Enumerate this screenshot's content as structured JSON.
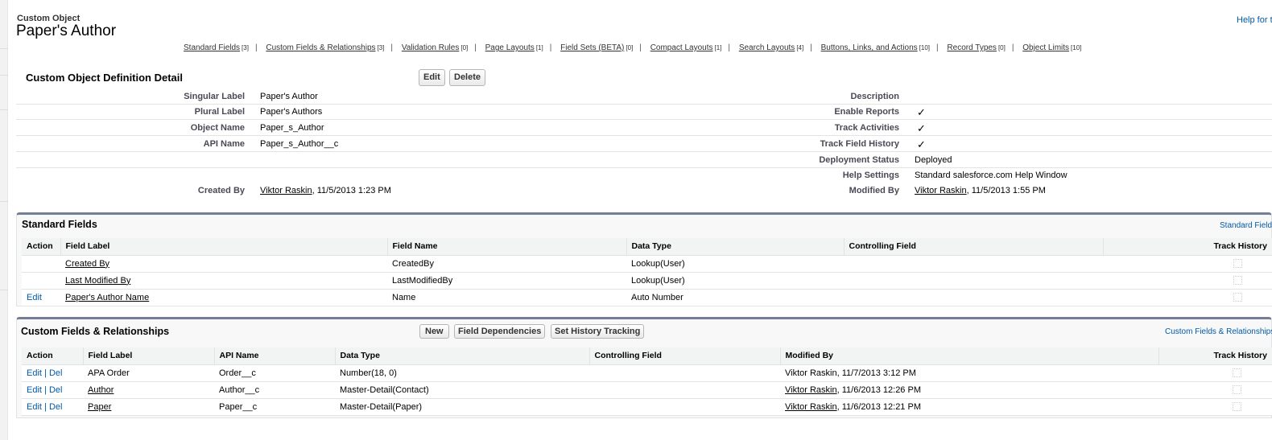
{
  "header": {
    "object_type": "Custom Object",
    "title": "Paper's Author",
    "help_link": "Help for this Page"
  },
  "nav_links": [
    {
      "label": "Standard Fields",
      "count": "[3]"
    },
    {
      "label": "Custom Fields & Relationships",
      "count": "[3]"
    },
    {
      "label": "Validation Rules",
      "count": "[0]"
    },
    {
      "label": "Page Layouts",
      "count": "[1]"
    },
    {
      "label": "Field Sets (BETA)",
      "count": "[0]"
    },
    {
      "label": "Compact Layouts",
      "count": "[1]"
    },
    {
      "label": "Search Layouts",
      "count": "[4]"
    },
    {
      "label": "Buttons, Links, and Actions",
      "count": "[10]"
    },
    {
      "label": "Record Types",
      "count": "[0]"
    },
    {
      "label": "Object Limits",
      "count": "[10]"
    }
  ],
  "detail": {
    "title": "Custom Object Definition Detail",
    "edit_button": "Edit",
    "delete_button": "Delete",
    "left": [
      {
        "label": "Singular Label",
        "value": "Paper's Author"
      },
      {
        "label": "Plural Label",
        "value": "Paper's Authors"
      },
      {
        "label": "Object Name",
        "value": "Paper_s_Author"
      },
      {
        "label": "API Name",
        "value": "Paper_s_Author__c"
      }
    ],
    "right": [
      {
        "label": "Description",
        "value": ""
      },
      {
        "label": "Enable Reports",
        "checked": true
      },
      {
        "label": "Track Activities",
        "checked": true
      },
      {
        "label": "Track Field History",
        "checked": true
      },
      {
        "label": "Deployment Status",
        "value": "Deployed"
      },
      {
        "label": "Help Settings",
        "value": "Standard salesforce.com Help Window"
      }
    ],
    "created_by": {
      "label": "Created By",
      "user": "Viktor Raskin",
      "date": ", 11/5/2013 1:23 PM"
    },
    "modified_by": {
      "label": "Modified By",
      "user": "Viktor Raskin",
      "date": ", 11/5/2013 1:55 PM"
    },
    "check_glyph": "✓"
  },
  "standard_fields": {
    "title": "Standard Fields",
    "help_link": "Standard Fields Help",
    "columns": [
      "Action",
      "Field Label",
      "Field Name",
      "Data Type",
      "Controlling Field",
      "Track History"
    ],
    "rows": [
      {
        "action": "",
        "label": "Created By",
        "name": "CreatedBy",
        "type": "Lookup(User)",
        "controlling": "",
        "track": false
      },
      {
        "action": "",
        "label": "Last Modified By",
        "name": "LastModifiedBy",
        "type": "Lookup(User)",
        "controlling": "",
        "track": false
      },
      {
        "action": "Edit",
        "label": "Paper's Author Name",
        "name": "Name",
        "type": "Auto Number",
        "controlling": "",
        "track": false
      }
    ]
  },
  "custom_fields": {
    "title": "Custom Fields & Relationships",
    "help_link": "Custom Fields & Relationships Help",
    "buttons": {
      "new": "New",
      "field_dependencies": "Field Dependencies",
      "set_history": "Set History Tracking"
    },
    "columns": [
      "Action",
      "Field Label",
      "API Name",
      "Data Type",
      "Controlling Field",
      "Modified By",
      "Track History"
    ],
    "action_edit": "Edit",
    "action_sep": " | ",
    "action_del": "Del",
    "rows": [
      {
        "label": "APA Order",
        "label_link": false,
        "api": "Order__c",
        "type": "Number(18, 0)",
        "controlling": "",
        "user": "Viktor Raskin",
        "user_link": false,
        "date": ", 11/7/2013 3:12 PM",
        "track": false
      },
      {
        "label": "Author",
        "label_link": true,
        "api": "Author__c",
        "type": "Master-Detail(Contact)",
        "controlling": "",
        "user": "Viktor Raskin",
        "user_link": true,
        "date": ", 11/6/2013 12:26 PM",
        "track": false
      },
      {
        "label": "Paper",
        "label_link": true,
        "api": "Paper__c",
        "type": "Master-Detail(Paper)",
        "controlling": "",
        "user": "Viktor Raskin",
        "user_link": true,
        "date": ", 11/6/2013 12:21 PM",
        "track": false
      }
    ]
  }
}
